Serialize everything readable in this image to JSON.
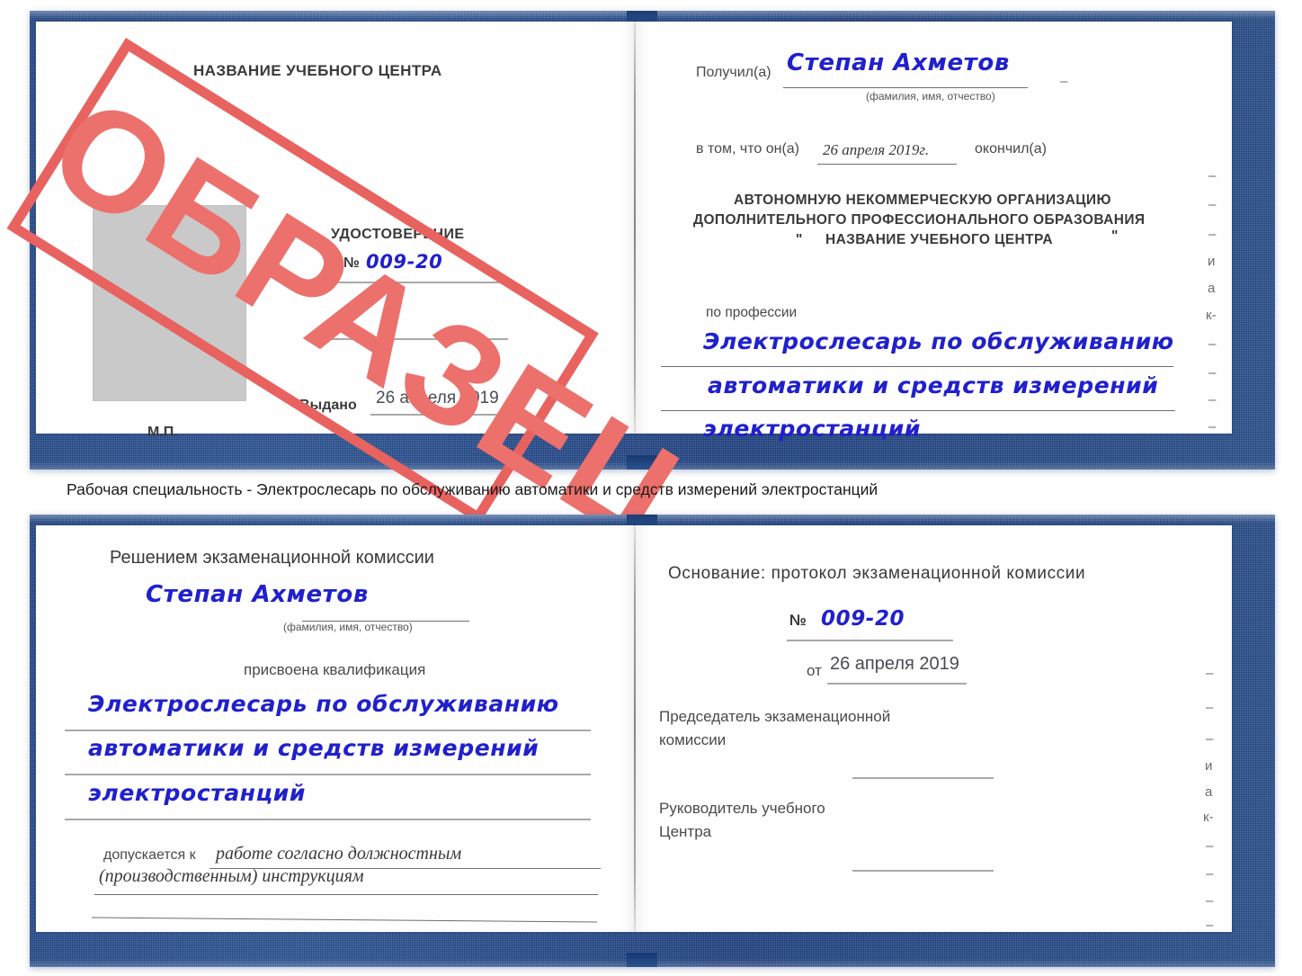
{
  "caption": {
    "text": "Рабочая специальность - Электрослесарь по обслуживанию автоматики и средств измерений электростанций"
  },
  "watermark": {
    "label": "ОБРАЗЕЦ",
    "color": "#ec706c"
  },
  "colors": {
    "cover_blue": "#20478a",
    "ink_blue": "#2020cc",
    "stamp_red": "#e8625f",
    "photo_grey": "#c9c9c9",
    "rule_grey": "#a9a9a9"
  },
  "certificate_top": {
    "left_page": {
      "center_name": "НАЗВАНИЕ УЧЕБНОГО ЦЕНТРА",
      "doc_type": "УДОСТОВЕРЕНИЕ",
      "number_label": "№",
      "number_value": "009-20",
      "issued_label": "Выдано",
      "issued_date": "26 апреля 2019",
      "seal_label": "М.П.",
      "photo_placeholder": "photo-placeholder"
    },
    "right_page": {
      "received_label": "Получил(а)",
      "received_name": "Степан Ахметов",
      "name_hint": "(фамилия, имя, отчество)",
      "statement_prefix": "в том, что он(а)",
      "statement_date": "26 апреля 2019г.",
      "statement_suffix": "окончил(а)",
      "org_line1": "АВТОНОМНУЮ НЕКОММЕРЧЕСКУЮ ОРГАНИЗАЦИЮ",
      "org_line2": "ДОПОЛНИТЕЛЬНОГО ПРОФЕССИОНАЛЬНОГО ОБРАЗОВАНИЯ",
      "org_quote_open": "\"",
      "org_line3": "НАЗВАНИЕ УЧЕБНОГО ЦЕНТРА",
      "org_quote_close": "\"",
      "profession_label": "по профессии",
      "profession_line1": "Электрослесарь по обслуживанию",
      "profession_line2": "автоматики и средств измерений",
      "profession_line3": "электростанций",
      "margin_marks": [
        "–",
        "–",
        "–",
        "и",
        "а",
        "к-",
        "–",
        "–",
        "–",
        "–"
      ]
    }
  },
  "certificate_bottom": {
    "left_page": {
      "decision_title": "Решением экзаменационной комиссии",
      "person_name": "Степан Ахметов",
      "name_hint": "(фамилия, имя, отчество)",
      "qualification_label": "присвоена квалификация",
      "qualification_line1": "Электрослесарь по обслуживанию",
      "qualification_line2": "автоматики и средств измерений",
      "qualification_line3": "электростанций",
      "admitted_label": "допускается к",
      "admitted_line1": "работе согласно должностным",
      "admitted_line2": "(производственным) инструкциям"
    },
    "right_page": {
      "basis_label": "Основание: протокол экзаменационной комиссии",
      "number_label": "№",
      "number_value": "009-20",
      "date_label": "от",
      "date_value": "26 апреля 2019",
      "chair_line1": "Председатель экзаменационной",
      "chair_line2": "комиссии",
      "head_line1": "Руководитель учебного",
      "head_line2": "Центра",
      "margin_marks": [
        "–",
        "–",
        "–",
        "и",
        "а",
        "к-",
        "–",
        "–",
        "–",
        "–"
      ]
    }
  }
}
